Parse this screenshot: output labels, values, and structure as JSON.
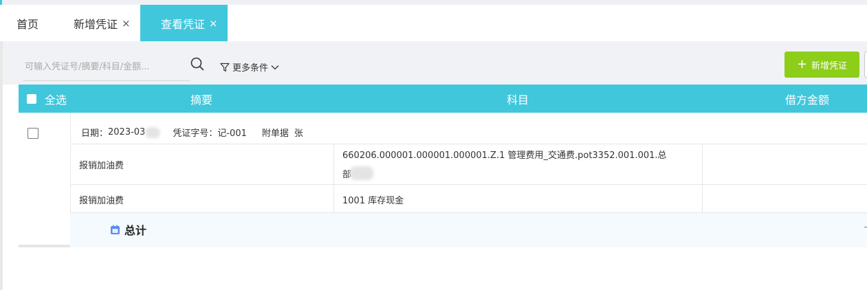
{
  "tabs": [
    {
      "label": "首页",
      "closable": false,
      "active": false
    },
    {
      "label": "新增凭证",
      "closable": true,
      "active": false
    },
    {
      "label": "查看凭证",
      "closable": true,
      "active": true
    }
  ],
  "close_glyph": "×",
  "filter": {
    "search_placeholder": "可输入凭证号/摘要/科目/金额...",
    "search_icon": "search-icon",
    "more_conditions": "更多条件",
    "add_button": "新增凭证"
  },
  "table": {
    "select_all": "全选",
    "columns": [
      "摘要",
      "科目",
      "借方金额"
    ]
  },
  "voucher": {
    "date_label": "日期：",
    "date_value": "2023-03",
    "number_label": "凭证字号：",
    "number_value": "记-001",
    "attach_label": "附单据",
    "attach_value": "张",
    "entries": [
      {
        "summary": "报销加油费",
        "account_line1": "660206.000001.000001.000001.Z.1  管理费用_交通费.pot3352.001.001.总",
        "account_line2": "部"
      },
      {
        "summary": "报销加油费",
        "account_line1": "1001 库存现金",
        "account_line2": ""
      }
    ],
    "total_label": "总计"
  },
  "colors": {
    "accent": "#40c7dc",
    "add_button": "#8cce19",
    "total_row": "#f4fafd"
  }
}
